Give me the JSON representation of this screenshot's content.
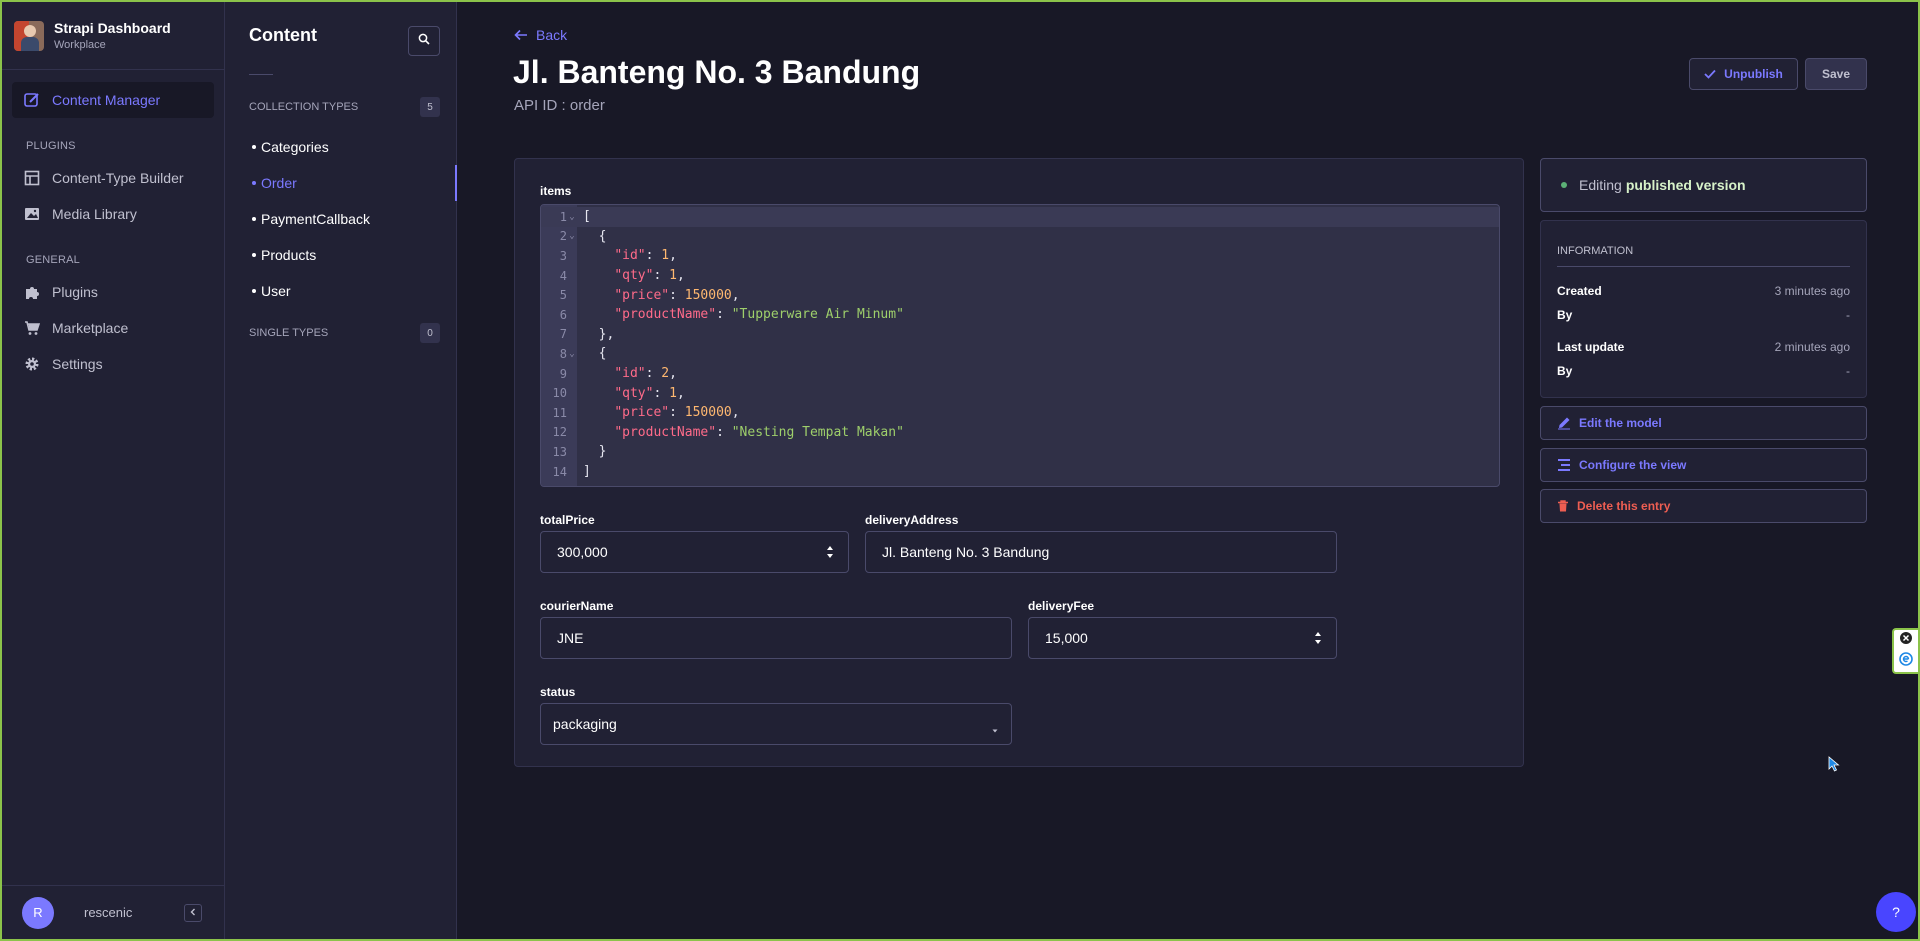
{
  "brand": {
    "title": "Strapi Dashboard",
    "subtitle": "Workplace"
  },
  "main_nav": {
    "content_manager": "Content Manager",
    "plugins_section": "PLUGINS",
    "content_type_builder": "Content-Type Builder",
    "media_library": "Media Library",
    "general_section": "GENERAL",
    "plugins": "Plugins",
    "marketplace": "Marketplace",
    "settings": "Settings"
  },
  "user": {
    "initial": "R",
    "name": "rescenic"
  },
  "sub_nav": {
    "title": "Content",
    "collection_label": "COLLECTION TYPES",
    "collection_count": "5",
    "collection_items": [
      "Categories",
      "Order",
      "PaymentCallback",
      "Products",
      "User"
    ],
    "single_label": "SINGLE TYPES",
    "single_count": "0"
  },
  "header": {
    "back": "Back",
    "title": "Jl. Banteng No. 3 Bandung",
    "api_id": "API ID : order",
    "unpublish": "Unpublish",
    "save": "Save"
  },
  "form": {
    "items_label": "items",
    "code_lines": [
      "[",
      "  {",
      "    \"id\": 1,",
      "    \"qty\": 1,",
      "    \"price\": 150000,",
      "    \"productName\": \"Tupperware Air Minum\"",
      "  },",
      "  {",
      "    \"id\": 2,",
      "    \"qty\": 1,",
      "    \"price\": 150000,",
      "    \"productName\": \"Nesting Tempat Makan\"",
      "  }",
      "]"
    ],
    "total_price_label": "totalPrice",
    "total_price": "300,000",
    "delivery_address_label": "deliveryAddress",
    "delivery_address": "Jl. Banteng No. 3 Bandung",
    "courier_name_label": "courierName",
    "courier_name": "JNE",
    "delivery_fee_label": "deliveryFee",
    "delivery_fee": "15,000",
    "status_label": "status",
    "status": "packaging"
  },
  "right_panel": {
    "editing_prefix": "Editing",
    "editing_version": "published version",
    "info_title": "INFORMATION",
    "created_label": "Created",
    "created_value": "3 minutes ago",
    "created_by_label": "By",
    "created_by_value": "-",
    "updated_label": "Last update",
    "updated_value": "2 minutes ago",
    "updated_by_label": "By",
    "updated_by_value": "-",
    "edit_model": "Edit the model",
    "configure_view": "Configure the view",
    "delete_entry": "Delete this entry"
  },
  "help": "?",
  "colors": {
    "accent": "#7b79ff",
    "danger": "#ee5e52",
    "success": "#5cb176",
    "background": "#181826",
    "panel": "#212134"
  }
}
